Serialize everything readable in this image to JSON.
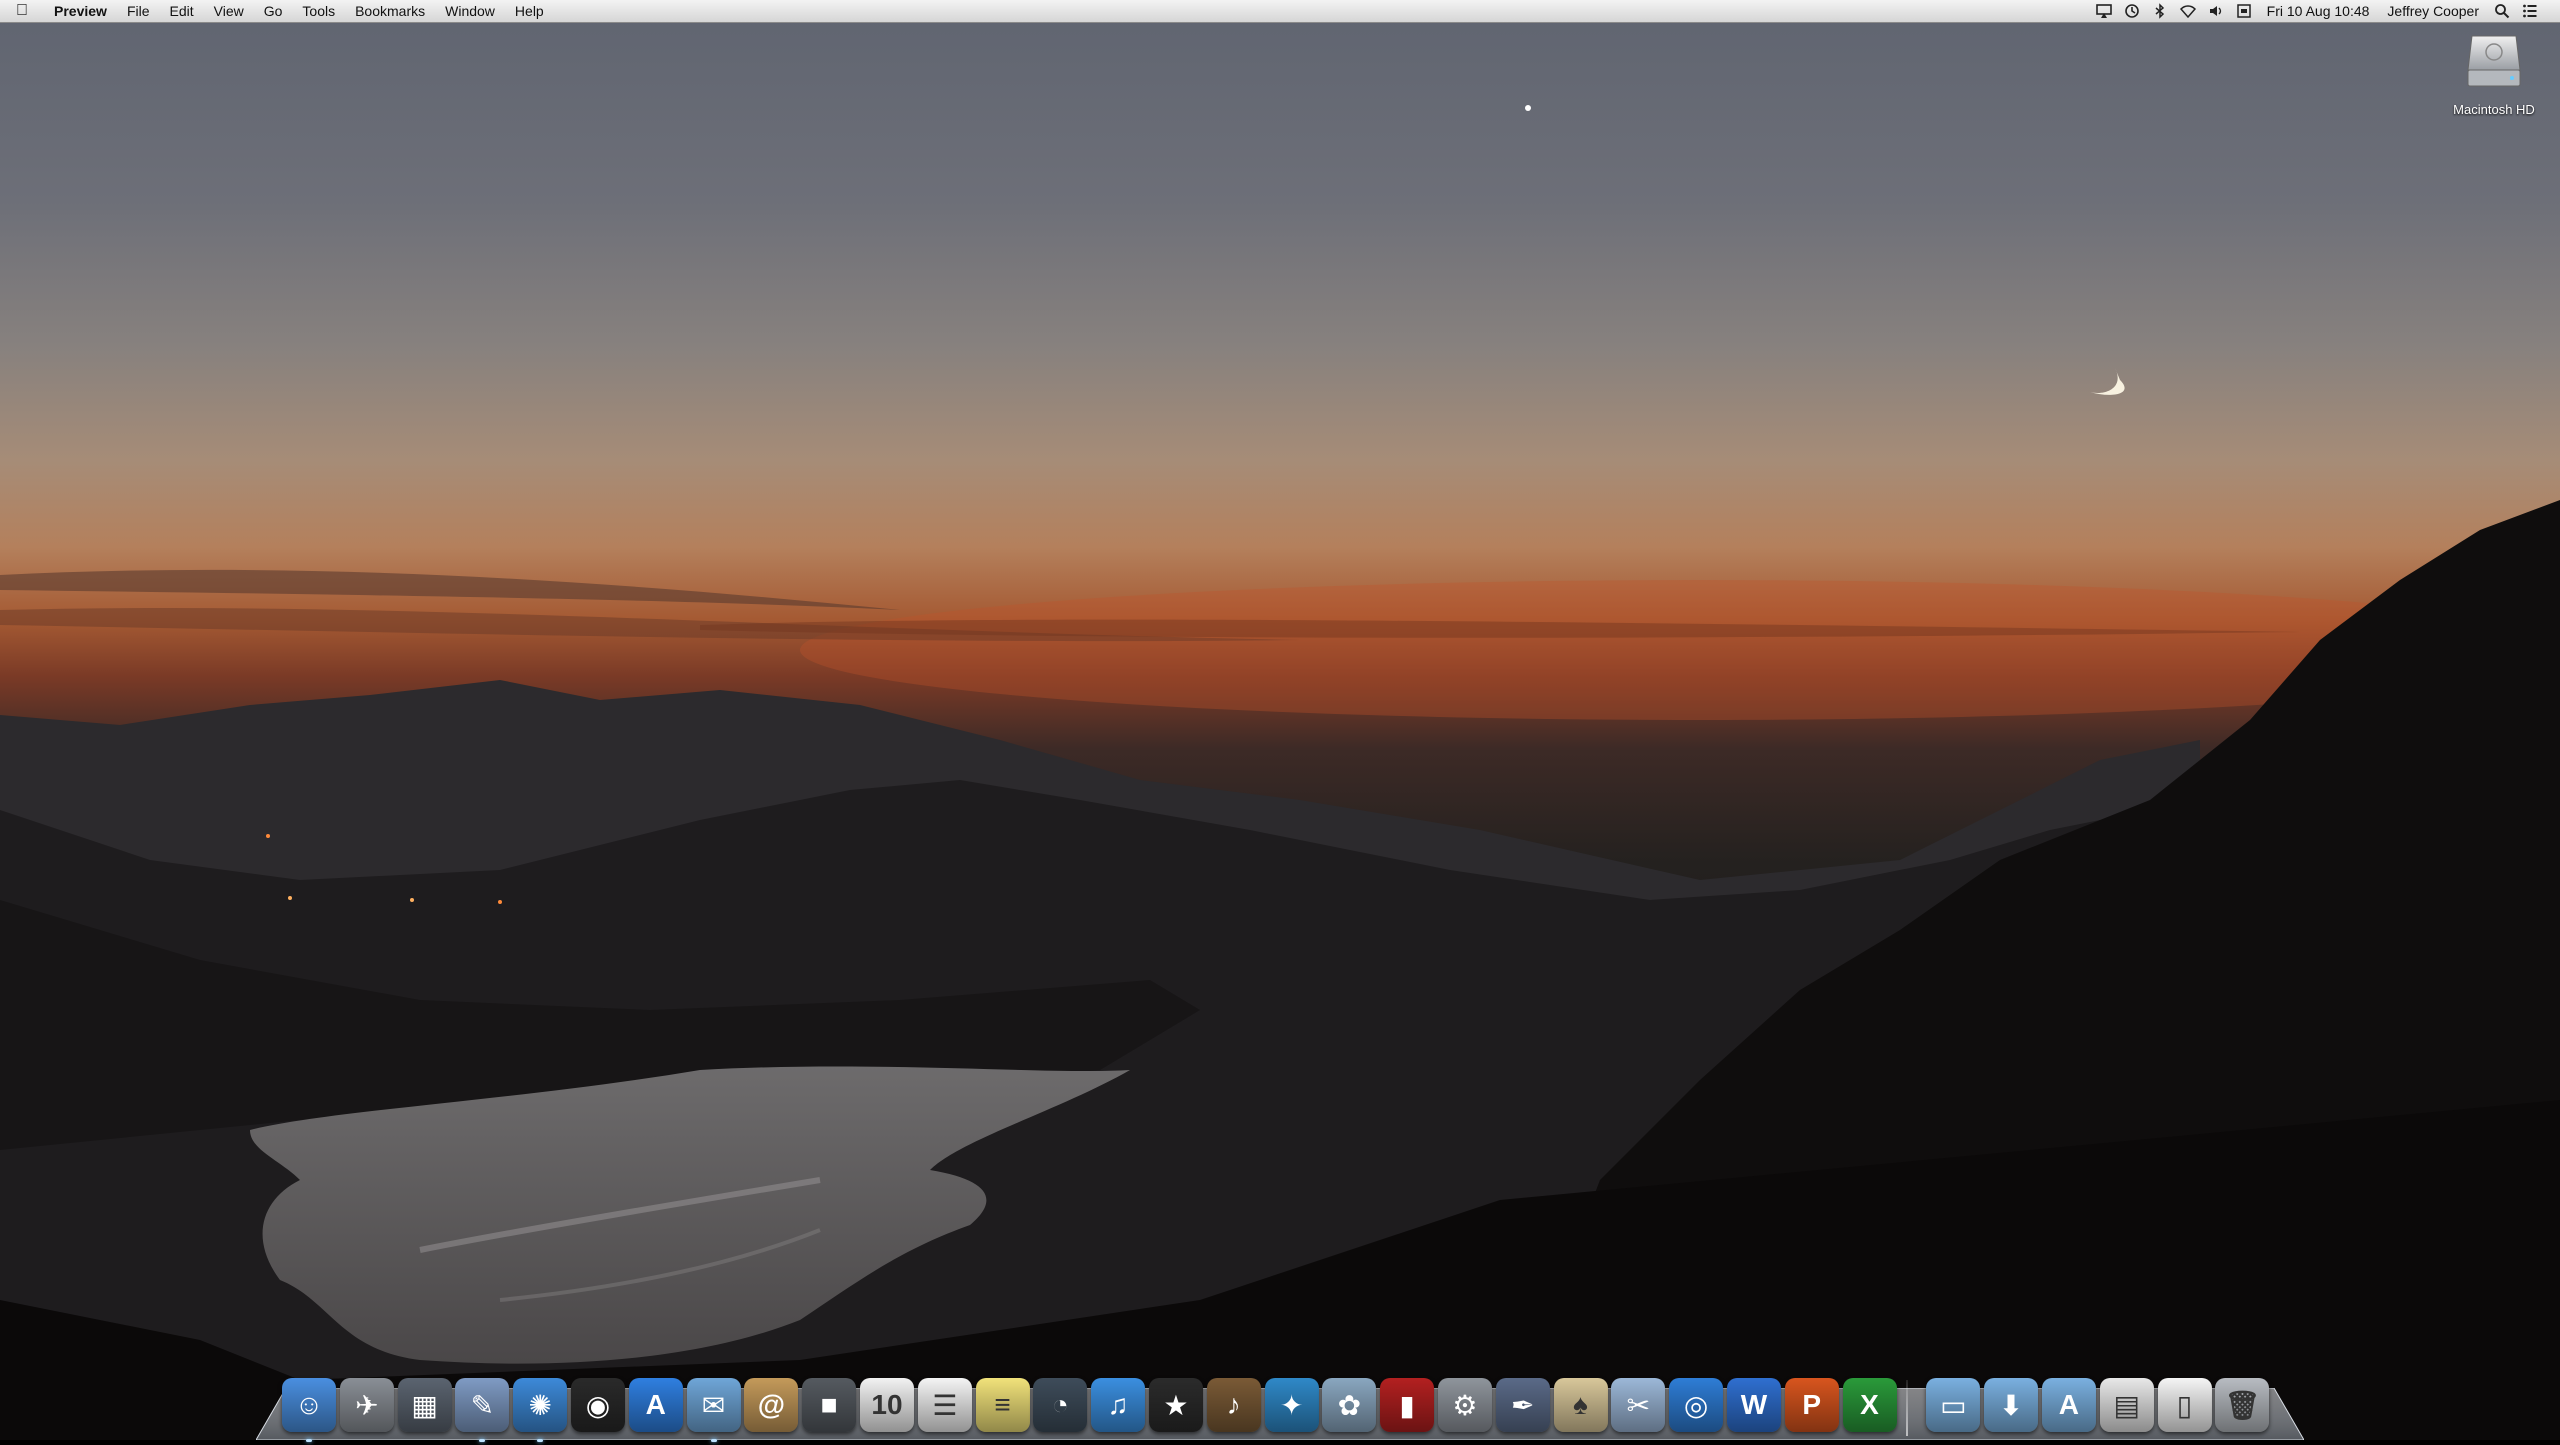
{
  "menubar": {
    "apple_icon": "apple-icon",
    "app_name": "Preview",
    "menus": [
      "File",
      "Edit",
      "View",
      "Go",
      "Tools",
      "Bookmarks",
      "Window",
      "Help"
    ],
    "status_icons": [
      "airplay-icon",
      "time-machine-icon",
      "bluetooth-icon",
      "wifi-icon",
      "volume-icon",
      "input-menu-icon"
    ],
    "clock": "Fri 10 Aug  10:48",
    "user": "Jeffrey Cooper",
    "right_icons": [
      "spotlight-icon",
      "notification-center-icon"
    ]
  },
  "desktop": {
    "drive_label": "Macintosh HD",
    "drive_icon": "hard-drive-icon"
  },
  "dock": {
    "apps": [
      {
        "icon": "finder-icon",
        "color": "#4a8fe0",
        "glyph": "☺",
        "running": true
      },
      {
        "icon": "launchpad-icon",
        "color": "#8a8f96",
        "glyph": "✈",
        "running": false
      },
      {
        "icon": "mission-control-icon",
        "color": "#5b6470",
        "glyph": "▦",
        "running": false
      },
      {
        "icon": "preview-icon",
        "color": "#7f9bc4",
        "glyph": "✎",
        "running": true
      },
      {
        "icon": "safari-icon",
        "color": "#3d8ad9",
        "glyph": "✺",
        "running": true
      },
      {
        "icon": "photo-booth-icon",
        "color": "#2a2a2a",
        "glyph": "◉",
        "running": false
      },
      {
        "icon": "app-store-icon",
        "color": "#2f7fe0",
        "glyph": "A",
        "running": false
      },
      {
        "icon": "mail-icon",
        "color": "#6fa6d8",
        "glyph": "✉",
        "running": true
      },
      {
        "icon": "contacts-icon",
        "color": "#c49a5a",
        "glyph": "@",
        "running": false
      },
      {
        "icon": "facetime-icon",
        "color": "#555a60",
        "glyph": "■",
        "running": false
      },
      {
        "icon": "calendar-icon",
        "color": "#f2f2f2",
        "glyph": "10",
        "running": false
      },
      {
        "icon": "reminders-icon",
        "color": "#f4f4f4",
        "glyph": "☰",
        "running": false
      },
      {
        "icon": "notes-icon",
        "color": "#f1e27a",
        "glyph": "≡",
        "running": false
      },
      {
        "icon": "time-machine-app-icon",
        "color": "#3e4c5a",
        "glyph": "◔",
        "running": false
      },
      {
        "icon": "itunes-icon",
        "color": "#3b8fe0",
        "glyph": "♫",
        "running": false
      },
      {
        "icon": "imovie-icon",
        "color": "#2b2b2b",
        "glyph": "★",
        "running": false
      },
      {
        "icon": "garageband-icon",
        "color": "#7a5a36",
        "glyph": "♪",
        "running": false
      },
      {
        "icon": "twitter-icon",
        "color": "#2f89c8",
        "glyph": "✦",
        "running": false
      },
      {
        "icon": "iphoto-icon",
        "color": "#8aa7c0",
        "glyph": "✿",
        "running": false
      },
      {
        "icon": "photo-booth-red-icon",
        "color": "#b32020",
        "glyph": "▮",
        "running": false
      },
      {
        "icon": "system-preferences-icon",
        "color": "#8f959c",
        "glyph": "⚙",
        "running": false
      },
      {
        "icon": "script-editor-icon",
        "color": "#5a6a88",
        "glyph": "✒",
        "running": false
      },
      {
        "icon": "solitaire-icon",
        "color": "#d8c79a",
        "glyph": "♠",
        "running": false
      },
      {
        "icon": "image-capture-icon",
        "color": "#9cb8d8",
        "glyph": "✂",
        "running": false
      },
      {
        "icon": "network-icon",
        "color": "#2e7dd6",
        "glyph": "◎",
        "running": false
      },
      {
        "icon": "word-icon",
        "color": "#2f6fd0",
        "glyph": "W",
        "running": false
      },
      {
        "icon": "powerpoint-icon",
        "color": "#d8551e",
        "glyph": "P",
        "running": false
      },
      {
        "icon": "excel-icon",
        "color": "#2a9a3a",
        "glyph": "X",
        "running": false
      }
    ],
    "stacks": [
      {
        "icon": "documents-folder-icon",
        "color": "#7ab0e0",
        "glyph": "▭"
      },
      {
        "icon": "downloads-folder-icon",
        "color": "#7ab0e0",
        "glyph": "⬇"
      },
      {
        "icon": "applications-folder-icon",
        "color": "#7ab0e0",
        "glyph": "A"
      },
      {
        "icon": "screenshot-stack-icon",
        "color": "#e8e8e8",
        "glyph": "▤"
      },
      {
        "icon": "document-stack-icon",
        "color": "#f5f5f5",
        "glyph": "▯"
      },
      {
        "icon": "trash-icon",
        "color": "#b8bcc2",
        "glyph": "🗑"
      }
    ]
  }
}
